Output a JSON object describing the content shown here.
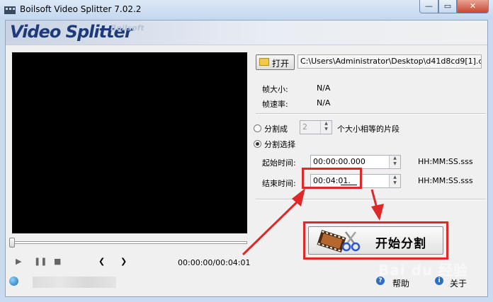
{
  "window": {
    "title": "Boilsoft Video Splitter 7.02.2",
    "controls": {
      "minimize": "—",
      "maximize": "▭",
      "close": "✕"
    }
  },
  "banner": {
    "logo": "Video Splitter",
    "brand": "Boilsoft"
  },
  "player": {
    "time_display": "00:00:00/00:04:01",
    "controls": {
      "play": "▶",
      "pause": "❚❚",
      "stop": "■",
      "prev": "❮",
      "next": "❯"
    }
  },
  "file": {
    "open_label": "打开",
    "path": "C:\\Users\\Administrator\\Desktop\\d41d8cd9[1].dat"
  },
  "info": {
    "frame_size_label": "帧大小:",
    "frame_size_value": "N/A",
    "frame_rate_label": "帧速率:",
    "frame_rate_value": "N/A"
  },
  "split": {
    "option_equal_label": "分割成",
    "equal_count": "2",
    "equal_suffix": "个大小相等的片段",
    "option_select_label": "分割选择",
    "selected_option": "select",
    "start_time_label": "起始时间:",
    "start_time_value": "00:00:00.000",
    "end_time_label": "结束时间:",
    "end_time_value": "00:04:01.",
    "time_format": "HH:MM:SS.sss"
  },
  "actions": {
    "start_label": "开始分割",
    "help_label": "帮助",
    "about_label": "关于"
  },
  "watermark": "Bai du 经验",
  "colors": {
    "annotation": "#e02828",
    "logo": "#1d3b7a",
    "title_bg": "#c9dbee"
  }
}
